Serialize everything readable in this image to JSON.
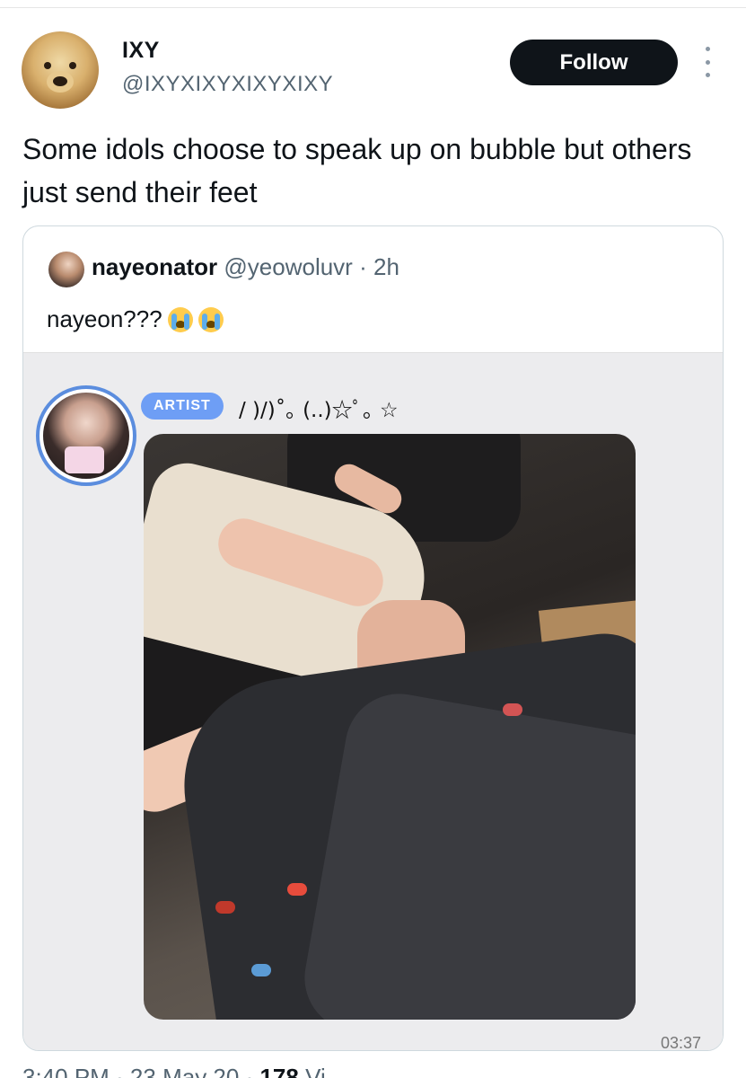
{
  "author": {
    "display_name": "IXY",
    "handle": "@IXYXIXYXIXYXIXY",
    "avatar_icon": "dog-avatar-icon"
  },
  "follow_label": "Follow",
  "tweet_text": "Some idols choose to speak up on bubble but others just send their feet",
  "quote": {
    "name": "nayeonator",
    "handle": "@yeowoluvr",
    "separator": "·",
    "time": "2h",
    "text": "nayeon???",
    "emoji_icons": [
      "loudly-crying-face-icon",
      "loudly-crying-face-icon"
    ],
    "bubble": {
      "badge": "ARTIST",
      "artist_name": "/ )/)˚｡ (..)☆ﾟ｡ ☆",
      "timestamp": "03:37"
    }
  },
  "footer": {
    "time_date": "3:40 PM · 23 May 20",
    "views_count": "178",
    "views_label": "Vi"
  },
  "colors": {
    "follow_bg": "#0f1419",
    "artist_badge": "#6e9ef5",
    "avatar_ring": "#5b8dde",
    "bubble_bg": "#ececee"
  }
}
